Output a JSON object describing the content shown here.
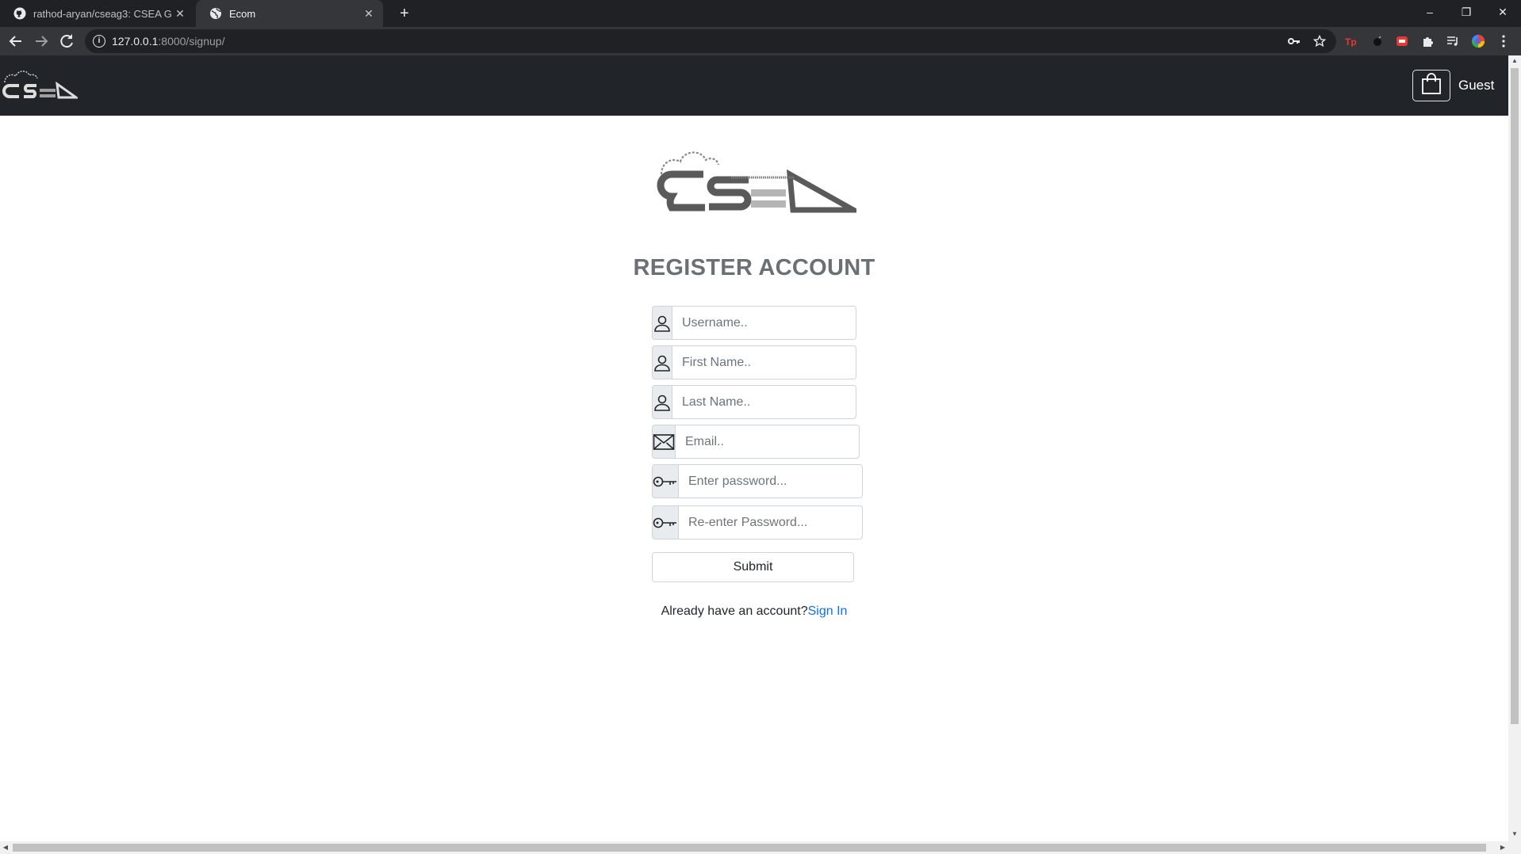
{
  "browser": {
    "tabs": [
      {
        "title": "rathod-aryan/cseag3: CSEA Grou",
        "favicon": "github-icon",
        "close": "✕"
      },
      {
        "title": "Ecom",
        "favicon": "globe-icon",
        "close": "✕"
      }
    ],
    "new_tab": "+",
    "window_controls": {
      "minimize": "–",
      "restore": "❐",
      "close": "✕"
    },
    "url_host": "127.0.0.1",
    "url_rest": ":8000/signup/"
  },
  "navbar": {
    "logo_alt": "CSEA",
    "user_label": "Guest",
    "bg_color": "#212529"
  },
  "signup": {
    "title": "REGISTER ACCOUNT",
    "fields": {
      "username": "Username..",
      "first_name": "First Name..",
      "last_name": "Last Name..",
      "email": "Email..",
      "password": "Enter password...",
      "password2": "Re-enter Password..."
    },
    "submit_label": "Submit",
    "footer_text": "Already have an account?",
    "signin_link": "Sign In",
    "link_color": "#0d6efd"
  }
}
